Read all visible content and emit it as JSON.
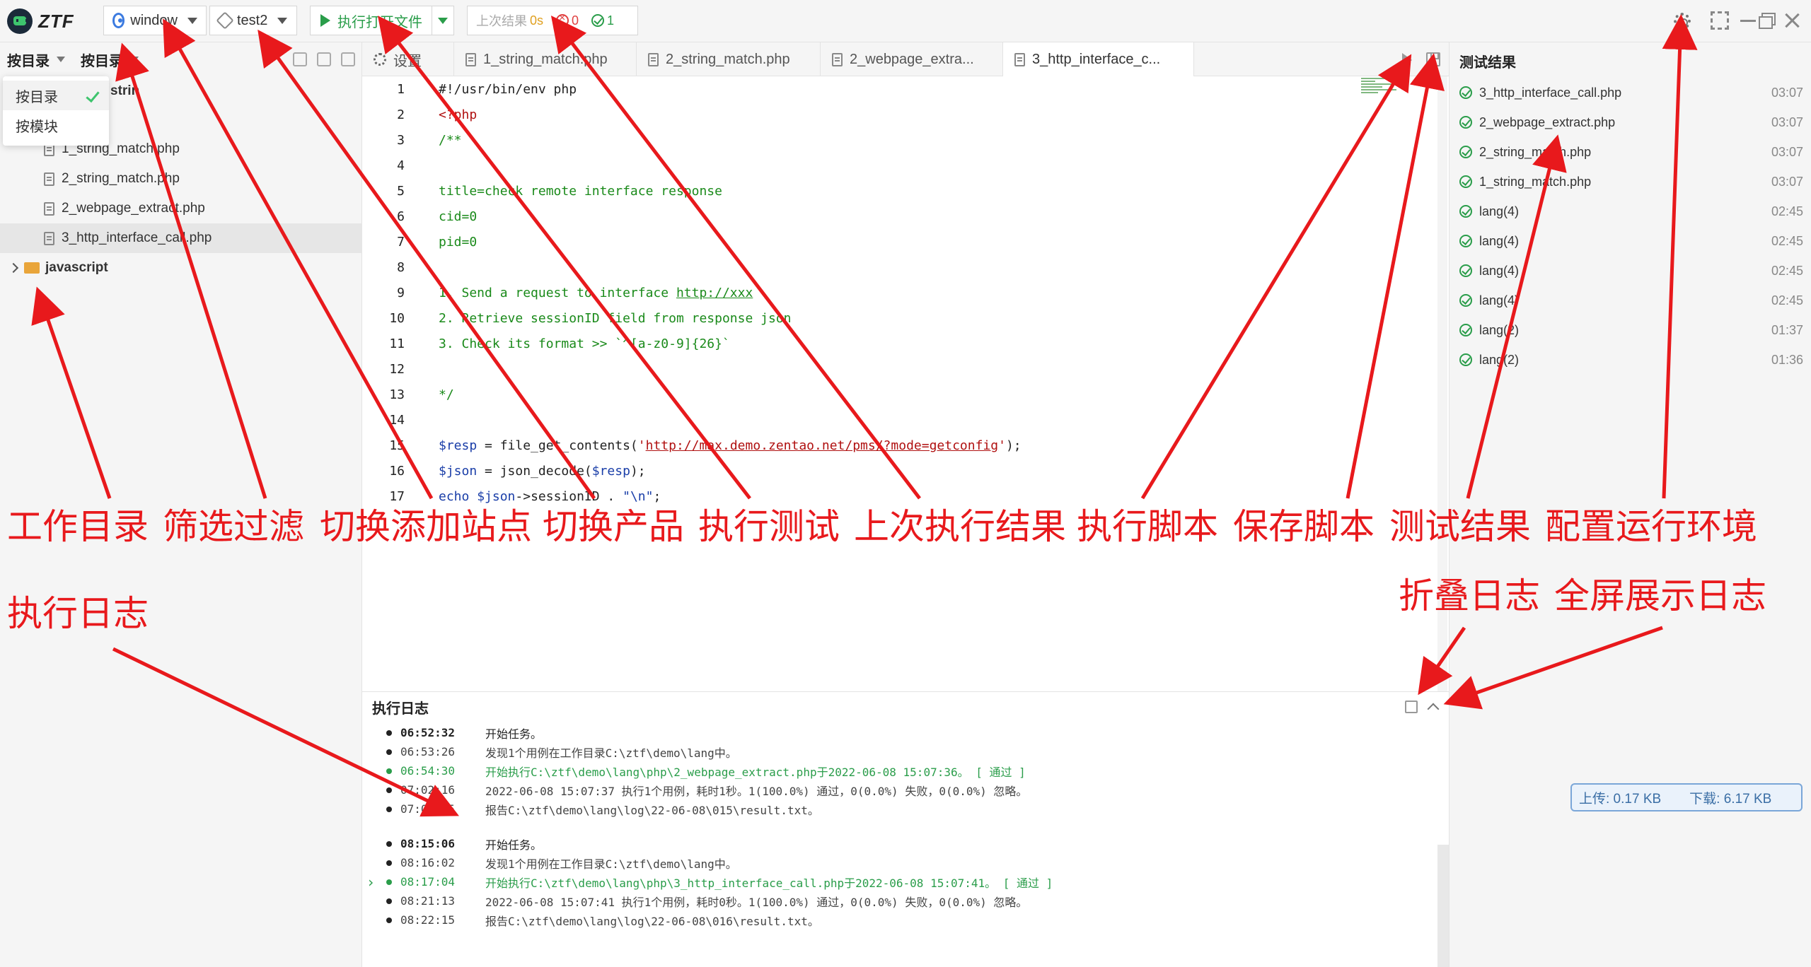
{
  "app": {
    "logo_text": "ZTF"
  },
  "toolbar": {
    "site_select": "window",
    "product_select": "test2",
    "run_button": "执行打开文件",
    "last_result_label": "上次结果",
    "last_duration": "0s",
    "fail_count": "0",
    "pass_count": "1"
  },
  "left": {
    "filter1": "按目录",
    "filter2": "按目录",
    "dropdown": [
      {
        "label": "按目录",
        "checked": true
      },
      {
        "label": "按模块",
        "checked": false
      }
    ],
    "partial_label": "strin",
    "files": [
      "1_string_match.php",
      "2_string_match.php",
      "2_webpage_extract.php",
      "3_http_interface_call.php"
    ],
    "folder": "javascript"
  },
  "tabs": [
    {
      "label": "设置",
      "icon": "gear-icon"
    },
    {
      "label": "1_string_match.php",
      "icon": "file-icon"
    },
    {
      "label": "2_string_match.php",
      "icon": "file-icon"
    },
    {
      "label": "2_webpage_extra...",
      "icon": "file-icon"
    },
    {
      "label": "3_http_interface_c...",
      "icon": "file-icon"
    }
  ],
  "editor": {
    "lines": [
      {
        "n": "1",
        "parts": [
          {
            "c": "fn",
            "t": "#!/usr/bin/env php"
          }
        ]
      },
      {
        "n": "2",
        "parts": [
          {
            "c": "kw",
            "t": "<?php"
          }
        ]
      },
      {
        "n": "3",
        "parts": [
          {
            "c": "cm",
            "t": "/**"
          }
        ]
      },
      {
        "n": "4",
        "parts": []
      },
      {
        "n": "5",
        "parts": [
          {
            "c": "cm",
            "t": "title=check remote interface response"
          }
        ]
      },
      {
        "n": "6",
        "parts": [
          {
            "c": "cm",
            "t": "cid=0"
          }
        ]
      },
      {
        "n": "7",
        "parts": [
          {
            "c": "cm",
            "t": "pid=0"
          }
        ]
      },
      {
        "n": "8",
        "parts": []
      },
      {
        "n": "9",
        "parts": [
          {
            "c": "cm",
            "t": "1. Send a request to interface "
          },
          {
            "c": "urlg",
            "t": "http://xxx"
          }
        ]
      },
      {
        "n": "10",
        "parts": [
          {
            "c": "cm",
            "t": "2. Retrieve sessionID field from response json"
          }
        ]
      },
      {
        "n": "11",
        "parts": [
          {
            "c": "cm",
            "t": "3. Check its format >> `^[a-z0-9]{26}`"
          }
        ]
      },
      {
        "n": "12",
        "parts": []
      },
      {
        "n": "13",
        "parts": [
          {
            "c": "cm",
            "t": "*/"
          }
        ]
      },
      {
        "n": "14",
        "parts": []
      },
      {
        "n": "15",
        "parts": [
          {
            "c": "var",
            "t": "$resp"
          },
          {
            "c": "fn",
            "t": " = file_get_contents("
          },
          {
            "c": "str",
            "t": "'"
          },
          {
            "c": "url",
            "t": "http://max.demo.zentao.net/pms/?mode=getconfig"
          },
          {
            "c": "str",
            "t": "'"
          },
          {
            "c": "fn",
            "t": ");"
          }
        ]
      },
      {
        "n": "16",
        "parts": [
          {
            "c": "var",
            "t": "$json"
          },
          {
            "c": "fn",
            "t": " = json_decode("
          },
          {
            "c": "var",
            "t": "$resp"
          },
          {
            "c": "fn",
            "t": ");"
          }
        ]
      },
      {
        "n": "17",
        "parts": [
          {
            "c": "var",
            "t": "echo"
          },
          {
            "c": "fn",
            "t": " "
          },
          {
            "c": "var",
            "t": "$json"
          },
          {
            "c": "fn",
            "t": "->sessionID . "
          },
          {
            "c": "var",
            "t": "\"\\n\""
          },
          {
            "c": "fn",
            "t": ";"
          }
        ]
      }
    ]
  },
  "log": {
    "title": "执行日志",
    "rows": [
      {
        "time": "06:52:32",
        "msg": "开始任务。",
        "style": "b",
        "dot": "k",
        "caret": false
      },
      {
        "time": "06:53:26",
        "msg": "发现1个用例在工作目录C:\\ztf\\demo\\lang中。",
        "style": "n",
        "dot": "k",
        "caret": false
      },
      {
        "time": "06:54:30",
        "msg": "开始执行C:\\ztf\\demo\\lang\\php\\2_webpage_extract.php于2022-06-08 15:07:36。 [ 通过 ]",
        "style": "g",
        "dot": "g",
        "caret": false
      },
      {
        "time": "07:02:16",
        "msg": "2022-06-08 15:07:37 执行1个用例，耗时1秒。1(100.0%) 通过，0(0.0%) 失败，0(0.0%) 忽略。",
        "style": "n",
        "dot": "k",
        "caret": false
      },
      {
        "time": "07:03:15",
        "msg": "报告C:\\ztf\\demo\\lang\\log\\22-06-08\\015\\result.txt。",
        "style": "n",
        "dot": "k",
        "caret": false
      },
      {
        "time": "08:15:06",
        "msg": "开始任务。",
        "style": "b",
        "dot": "k",
        "caret": false
      },
      {
        "time": "08:16:02",
        "msg": "发现1个用例在工作目录C:\\ztf\\demo\\lang中。",
        "style": "n",
        "dot": "k",
        "caret": false
      },
      {
        "time": "08:17:04",
        "msg": "开始执行C:\\ztf\\demo\\lang\\php\\3_http_interface_call.php于2022-06-08 15:07:41。 [ 通过 ]",
        "style": "g",
        "dot": "g",
        "caret": true
      },
      {
        "time": "08:21:13",
        "msg": "2022-06-08 15:07:41 执行1个用例，耗时0秒。1(100.0%) 通过，0(0.0%) 失败，0(0.0%) 忽略。",
        "style": "n",
        "dot": "k",
        "caret": false
      },
      {
        "time": "08:22:15",
        "msg": "报告C:\\ztf\\demo\\lang\\log\\22-06-08\\016\\result.txt。",
        "style": "n",
        "dot": "k",
        "caret": false
      }
    ]
  },
  "results": {
    "title": "测试结果",
    "items": [
      {
        "name": "3_http_interface_call.php",
        "time": "03:07"
      },
      {
        "name": "2_webpage_extract.php",
        "time": "03:07"
      },
      {
        "name": "2_string_match.php",
        "time": "03:07"
      },
      {
        "name": "1_string_match.php",
        "time": "03:07"
      },
      {
        "name": "lang(4)",
        "time": "02:45"
      },
      {
        "name": "lang(4)",
        "time": "02:45"
      },
      {
        "name": "lang(4)",
        "time": "02:45"
      },
      {
        "name": "lang(4)",
        "time": "02:45"
      },
      {
        "name": "lang(2)",
        "time": "01:37"
      },
      {
        "name": "lang(2)",
        "time": "01:36"
      }
    ]
  },
  "network": {
    "upload": "上传: 0.17 KB",
    "download": "下载: 6.17 KB"
  },
  "annotations": {
    "work_dir": "工作目录",
    "filter": "筛选过滤",
    "switch_site": "切换添加站点",
    "switch_product": "切换产品",
    "run_test": "执行测试",
    "last_result": "上次执行结果",
    "run_script": "执行脚本",
    "save_script": "保存脚本",
    "test_results": "测试结果",
    "config_env": "配置运行环境",
    "exec_log": "执行日志",
    "fold_log": "折叠日志",
    "fullscreen_log": "全屏展示日志"
  },
  "colors": {
    "annotation": "#e8191c",
    "pass": "#2a9d4a",
    "fail": "#e04040"
  }
}
